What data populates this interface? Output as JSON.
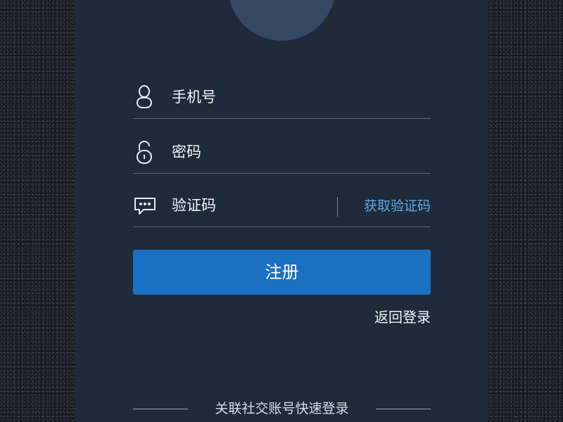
{
  "form": {
    "phone_label": "手机号",
    "password_label": "密码",
    "code_label": "验证码",
    "get_code": "获取验证码"
  },
  "actions": {
    "register": "注册",
    "back_to_login": "返回登录"
  },
  "social": {
    "label": "关联社交账号快速登录"
  },
  "colors": {
    "background": "#15191f",
    "card": "#1f2a3b",
    "avatar": "#344763",
    "primary": "#1a70c2",
    "link": "#5ea8e4",
    "divider": "#5a6778"
  },
  "icons": {
    "phone": "user-icon",
    "password": "lock-icon",
    "code": "message-icon"
  }
}
